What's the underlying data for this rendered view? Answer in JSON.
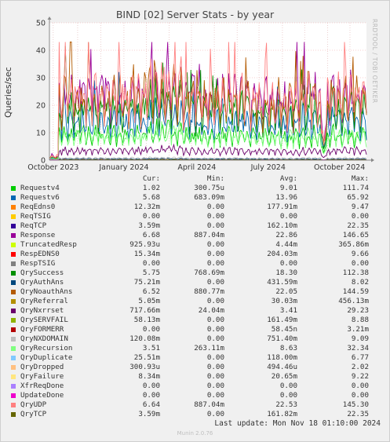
{
  "chart_data": {
    "type": "line",
    "title": "BIND [02] Server Stats - by year",
    "ylabel": "Queries/sec",
    "ylim": [
      0,
      50
    ],
    "yticks": [
      0,
      10,
      20,
      30,
      40,
      50
    ],
    "x_tick_labels": [
      "October 2023",
      "January 2024",
      "April 2024",
      "July 2024",
      "October 2024"
    ],
    "grid": true,
    "series": [
      {
        "name": "Requestv4",
        "color": "#00cc00",
        "cur": "1.02",
        "min": "300.75u",
        "avg": "9.01",
        "max": "111.74"
      },
      {
        "name": "Requestv6",
        "color": "#0066b3",
        "cur": "5.68",
        "min": "683.09m",
        "avg": "13.96",
        "max": "65.92"
      },
      {
        "name": "ReqEdns0",
        "color": "#ff8000",
        "cur": "12.32m",
        "min": "0.00",
        "avg": "177.91m",
        "max": "9.47"
      },
      {
        "name": "ReqTSIG",
        "color": "#ffcc00",
        "cur": "0.00",
        "min": "0.00",
        "avg": "0.00",
        "max": "0.00"
      },
      {
        "name": "ReqTCP",
        "color": "#330099",
        "cur": "3.59m",
        "min": "0.00",
        "avg": "162.10m",
        "max": "22.35"
      },
      {
        "name": "Response",
        "color": "#990099",
        "cur": "6.68",
        "min": "887.04m",
        "avg": "22.86",
        "max": "146.65"
      },
      {
        "name": "TruncatedResp",
        "color": "#ccff00",
        "cur": "925.93u",
        "min": "0.00",
        "avg": "4.44m",
        "max": "365.86m"
      },
      {
        "name": "RespEDNS0",
        "color": "#ff0000",
        "cur": "15.34m",
        "min": "0.00",
        "avg": "204.03m",
        "max": "9.66"
      },
      {
        "name": "RespTSIG",
        "color": "#808080",
        "cur": "0.00",
        "min": "0.00",
        "avg": "0.00",
        "max": "0.00"
      },
      {
        "name": "QrySuccess",
        "color": "#008f00",
        "cur": "5.75",
        "min": "768.69m",
        "avg": "18.30",
        "max": "112.38"
      },
      {
        "name": "QryAuthAns",
        "color": "#00487d",
        "cur": "75.21m",
        "min": "0.00",
        "avg": "431.59m",
        "max": "8.02"
      },
      {
        "name": "QryNoauthAns",
        "color": "#b35a00",
        "cur": "6.52",
        "min": "880.77m",
        "avg": "22.05",
        "max": "144.59"
      },
      {
        "name": "QryReferral",
        "color": "#b38f00",
        "cur": "5.05m",
        "min": "0.00",
        "avg": "30.03m",
        "max": "456.13m"
      },
      {
        "name": "QryNxrrset",
        "color": "#6b006b",
        "cur": "717.66m",
        "min": "24.04m",
        "avg": "3.41",
        "max": "29.23"
      },
      {
        "name": "QrySERVFAIL",
        "color": "#8fb300",
        "cur": "58.13m",
        "min": "0.00",
        "avg": "161.49m",
        "max": "8.88"
      },
      {
        "name": "QryFORMERR",
        "color": "#b30000",
        "cur": "0.00",
        "min": "0.00",
        "avg": "58.45n",
        "max": "3.21m"
      },
      {
        "name": "QryNXDOMAIN",
        "color": "#bebebe",
        "cur": "120.08m",
        "min": "0.00",
        "avg": "751.40m",
        "max": "9.09"
      },
      {
        "name": "QryRecursion",
        "color": "#80ff80",
        "cur": "3.51",
        "min": "263.11m",
        "avg": "8.63",
        "max": "32.34"
      },
      {
        "name": "QryDuplicate",
        "color": "#80c9ff",
        "cur": "25.51m",
        "min": "0.00",
        "avg": "118.00m",
        "max": "6.77"
      },
      {
        "name": "QryDropped",
        "color": "#ffc080",
        "cur": "300.93u",
        "min": "0.00",
        "avg": "494.46u",
        "max": "2.02"
      },
      {
        "name": "QryFailure",
        "color": "#ffe680",
        "cur": "8.34m",
        "min": "0.00",
        "avg": "20.65m",
        "max": "9.22"
      },
      {
        "name": "XfrReqDone",
        "color": "#aa80ff",
        "cur": "0.00",
        "min": "0.00",
        "avg": "0.00",
        "max": "0.00"
      },
      {
        "name": "UpdateDone",
        "color": "#ee00cc",
        "cur": "0.00",
        "min": "0.00",
        "avg": "0.00",
        "max": "0.00"
      },
      {
        "name": "QryUDP",
        "color": "#ff8080",
        "cur": "6.64",
        "min": "887.04m",
        "avg": "22.53",
        "max": "145.30"
      },
      {
        "name": "QryTCP",
        "color": "#666600",
        "cur": "3.59m",
        "min": "0.00",
        "avg": "161.82m",
        "max": "22.35"
      }
    ]
  },
  "legend_header": {
    "cur": "Cur:",
    "min": "Min:",
    "avg": "Avg:",
    "max": "Max:"
  },
  "watermark": "RRDTOOL / TOBI OETIKER",
  "last_update": "Last update: Mon Nov 18 01:10:00 2024",
  "munin_version": "Munin 2.0.76"
}
